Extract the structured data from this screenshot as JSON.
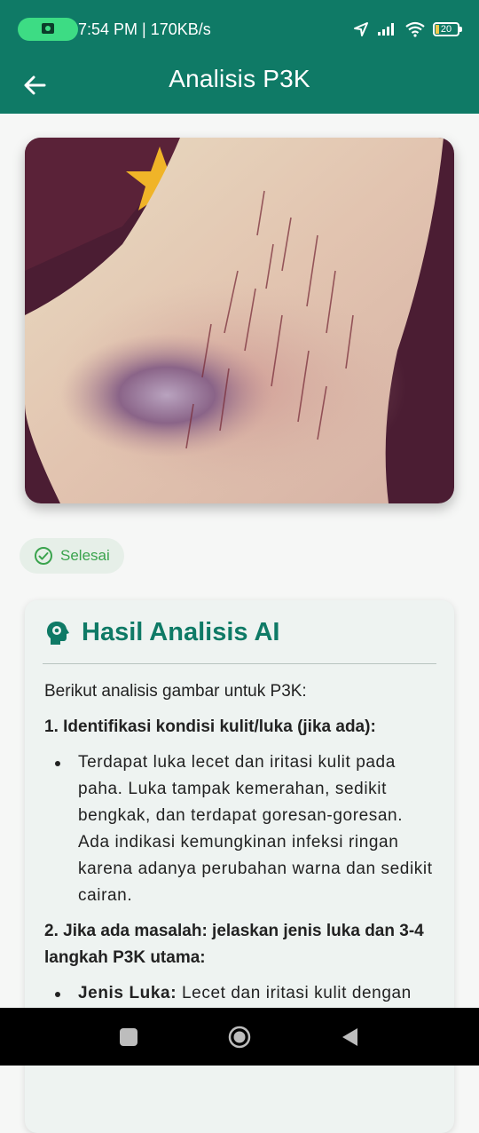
{
  "status_bar": {
    "text": "7:54 PM | 170KB/s",
    "battery": "20",
    "icons": [
      "camera-icon",
      "location-arrow-icon",
      "signal-icon",
      "wifi-icon",
      "battery-icon"
    ]
  },
  "app_bar": {
    "title": "Analisis P3K",
    "back_icon": "arrow-left-icon"
  },
  "status_chip": {
    "label": "Selesai",
    "icon": "check-circle-icon",
    "color": "#3aa34d"
  },
  "result": {
    "title": "Hasil Analisis AI",
    "icon": "brain-head-icon",
    "intro": "Berikut analisis gambar untuk P3K:",
    "section1_heading": "1. Identifikasi kondisi kulit/luka (jika ada):",
    "section1_bullet": "Terdapat luka lecet dan iritasi kulit pada paha.  Luka tampak kemerahan, sedikit bengkak, dan terdapat goresan-goresan. Ada indikasi kemungkinan infeksi ringan karena adanya perubahan warna dan sedikit cairan.",
    "section2_heading": "2. Jika ada masalah: jelaskan jenis luka dan 3-4 langkah P3K utama:",
    "section2_bullet_label": "Jenis Luka:",
    "section2_bullet_text": " Lecet dan iritasi kulit dengan"
  },
  "colors": {
    "primary": "#0f7a66",
    "background": "#f6f7f6",
    "card": "#eef3f1"
  },
  "nav_bar": {
    "icons": [
      "recents-square-icon",
      "home-circle-icon",
      "back-triangle-icon"
    ]
  }
}
